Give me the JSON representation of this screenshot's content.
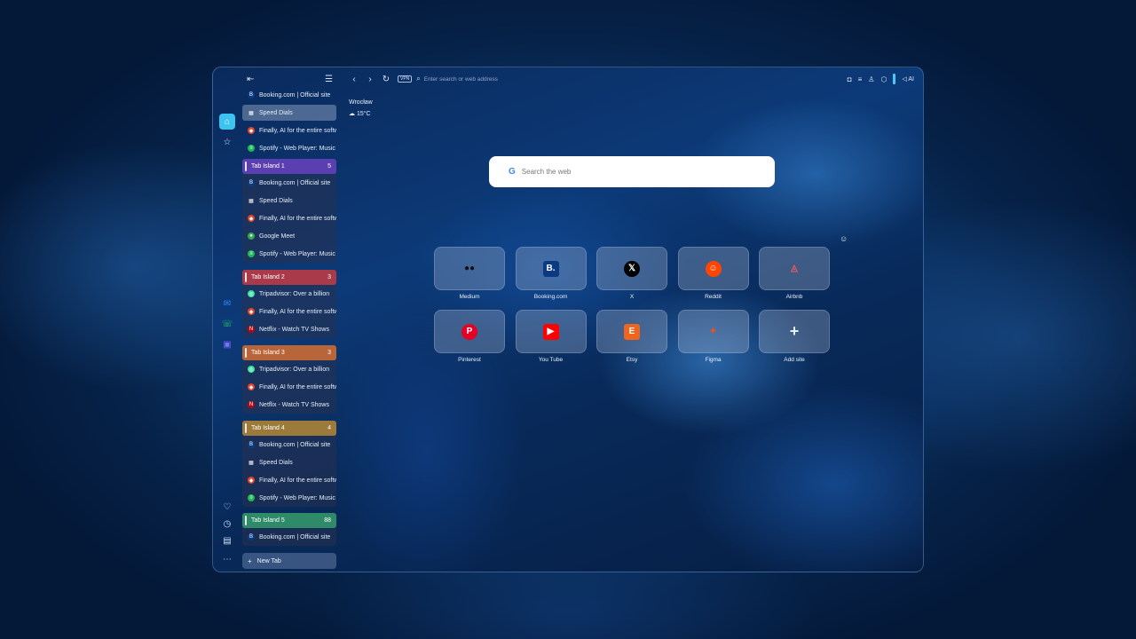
{
  "toolbar": {
    "vpn_label": "VPN",
    "address_placeholder": "Enter search or web address",
    "ai_label": "AI"
  },
  "weather": {
    "city": "Wrocław",
    "temp": "15°C"
  },
  "search": {
    "placeholder": "Search the web",
    "engine_logo": "G"
  },
  "sidebar": {
    "top_tabs": [
      {
        "title": "Booking.com | Official site",
        "icon": "B",
        "color": "#0b3a82",
        "selected": false
      },
      {
        "title": "Speed Dials",
        "icon": "▦",
        "color": "transparent",
        "selected": true
      },
      {
        "title": "Finally, AI for the entire software",
        "icon": "◆",
        "color": "#e24329",
        "selected": false
      },
      {
        "title": "Spotify - Web Player: Music",
        "icon": "≡",
        "color": "#1db954",
        "selected": false
      }
    ],
    "islands": [
      {
        "name": "Tab Island 1",
        "count": "5",
        "color": "#5a3fb0",
        "tabs": [
          {
            "title": "Booking.com | Official site",
            "icon": "B",
            "color": "#0b3a82"
          },
          {
            "title": "Speed Dials",
            "icon": "▦",
            "color": "transparent"
          },
          {
            "title": "Finally, AI for the entire software",
            "icon": "◆",
            "color": "#e24329"
          },
          {
            "title": "Google Meet",
            "icon": "●",
            "color": "#34a853"
          },
          {
            "title": "Spotify - Web Player: Music",
            "icon": "≡",
            "color": "#1db954"
          }
        ]
      },
      {
        "name": "Tab Island 2",
        "count": "3",
        "color": "#a83a4a",
        "tabs": [
          {
            "title": "Tripadvisor: Over a billion",
            "icon": "◎",
            "color": "#34e0a1"
          },
          {
            "title": "Finally, AI for the entire software",
            "icon": "◆",
            "color": "#e24329"
          },
          {
            "title": "Netflix - Watch TV Shows",
            "icon": "N",
            "color": "#b20710"
          }
        ]
      },
      {
        "name": "Tab Island 3",
        "count": "3",
        "color": "#b8653a",
        "tabs": [
          {
            "title": "Tripadvisor: Over a billion",
            "icon": "◎",
            "color": "#34e0a1"
          },
          {
            "title": "Finally, AI for the entire software",
            "icon": "◆",
            "color": "#e24329"
          },
          {
            "title": "Netflix - Watch TV Shows",
            "icon": "N",
            "color": "#b20710"
          }
        ]
      },
      {
        "name": "Tab Island 4",
        "count": "4",
        "color": "#9c7a3a",
        "tabs": [
          {
            "title": "Booking.com | Official site",
            "icon": "B",
            "color": "#0b3a82"
          },
          {
            "title": "Speed Dials",
            "icon": "▦",
            "color": "transparent"
          },
          {
            "title": "Finally, AI for the entire software",
            "icon": "◆",
            "color": "#e24329"
          },
          {
            "title": "Spotify - Web Player: Music",
            "icon": "≡",
            "color": "#1db954"
          }
        ]
      },
      {
        "name": "Tab Island 5",
        "count": "88",
        "color": "#2f8a6a",
        "tabs": [
          {
            "title": "Booking.com | Official site",
            "icon": "B",
            "color": "#0b3a82"
          }
        ]
      }
    ],
    "new_tab_label": "New Tab"
  },
  "speed_dials": [
    {
      "label": "Medium",
      "glyph": "●●",
      "bg": "transparent",
      "fg": "#111111"
    },
    {
      "label": "Booking.com",
      "glyph": "B.",
      "bg": "#0b3a82",
      "fg": "#ffffff"
    },
    {
      "label": "X",
      "glyph": "𝕏",
      "bg": "#000000",
      "fg": "#ffffff"
    },
    {
      "label": "Reddit",
      "glyph": "☺",
      "bg": "#ff4500",
      "fg": "#ffffff"
    },
    {
      "label": "Airbnb",
      "glyph": "◬",
      "bg": "transparent",
      "fg": "#ff5a5f"
    },
    {
      "label": "Pinterest",
      "glyph": "P",
      "bg": "#e60023",
      "fg": "#ffffff"
    },
    {
      "label": "You Tube",
      "glyph": "▶",
      "bg": "#ff0000",
      "fg": "#ffffff"
    },
    {
      "label": "Etsy",
      "glyph": "E",
      "bg": "#f1641e",
      "fg": "#ffffff"
    },
    {
      "label": "Figma",
      "glyph": "✦",
      "bg": "transparent",
      "fg": "#f24e1e"
    },
    {
      "label": "Add site",
      "glyph": "+",
      "bg": "transparent",
      "fg": "#e6eef9"
    }
  ]
}
